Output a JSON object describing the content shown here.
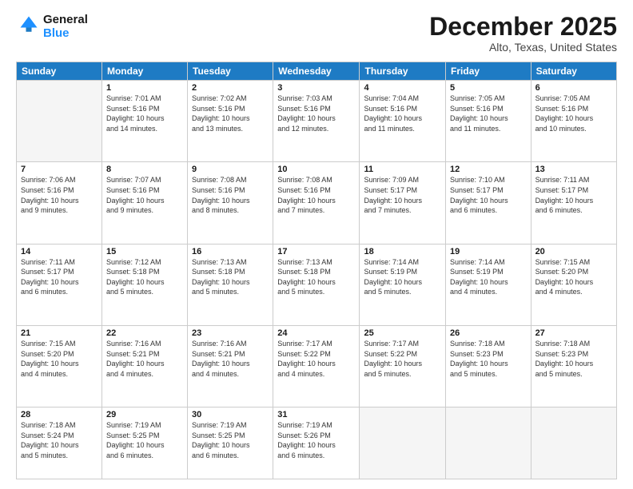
{
  "logo": {
    "line1": "General",
    "line2": "Blue"
  },
  "title": "December 2025",
  "subtitle": "Alto, Texas, United States",
  "header_days": [
    "Sunday",
    "Monday",
    "Tuesday",
    "Wednesday",
    "Thursday",
    "Friday",
    "Saturday"
  ],
  "weeks": [
    [
      {
        "num": "",
        "info": ""
      },
      {
        "num": "1",
        "info": "Sunrise: 7:01 AM\nSunset: 5:16 PM\nDaylight: 10 hours\nand 14 minutes."
      },
      {
        "num": "2",
        "info": "Sunrise: 7:02 AM\nSunset: 5:16 PM\nDaylight: 10 hours\nand 13 minutes."
      },
      {
        "num": "3",
        "info": "Sunrise: 7:03 AM\nSunset: 5:16 PM\nDaylight: 10 hours\nand 12 minutes."
      },
      {
        "num": "4",
        "info": "Sunrise: 7:04 AM\nSunset: 5:16 PM\nDaylight: 10 hours\nand 11 minutes."
      },
      {
        "num": "5",
        "info": "Sunrise: 7:05 AM\nSunset: 5:16 PM\nDaylight: 10 hours\nand 11 minutes."
      },
      {
        "num": "6",
        "info": "Sunrise: 7:05 AM\nSunset: 5:16 PM\nDaylight: 10 hours\nand 10 minutes."
      }
    ],
    [
      {
        "num": "7",
        "info": "Sunrise: 7:06 AM\nSunset: 5:16 PM\nDaylight: 10 hours\nand 9 minutes."
      },
      {
        "num": "8",
        "info": "Sunrise: 7:07 AM\nSunset: 5:16 PM\nDaylight: 10 hours\nand 9 minutes."
      },
      {
        "num": "9",
        "info": "Sunrise: 7:08 AM\nSunset: 5:16 PM\nDaylight: 10 hours\nand 8 minutes."
      },
      {
        "num": "10",
        "info": "Sunrise: 7:08 AM\nSunset: 5:16 PM\nDaylight: 10 hours\nand 7 minutes."
      },
      {
        "num": "11",
        "info": "Sunrise: 7:09 AM\nSunset: 5:17 PM\nDaylight: 10 hours\nand 7 minutes."
      },
      {
        "num": "12",
        "info": "Sunrise: 7:10 AM\nSunset: 5:17 PM\nDaylight: 10 hours\nand 6 minutes."
      },
      {
        "num": "13",
        "info": "Sunrise: 7:11 AM\nSunset: 5:17 PM\nDaylight: 10 hours\nand 6 minutes."
      }
    ],
    [
      {
        "num": "14",
        "info": "Sunrise: 7:11 AM\nSunset: 5:17 PM\nDaylight: 10 hours\nand 6 minutes."
      },
      {
        "num": "15",
        "info": "Sunrise: 7:12 AM\nSunset: 5:18 PM\nDaylight: 10 hours\nand 5 minutes."
      },
      {
        "num": "16",
        "info": "Sunrise: 7:13 AM\nSunset: 5:18 PM\nDaylight: 10 hours\nand 5 minutes."
      },
      {
        "num": "17",
        "info": "Sunrise: 7:13 AM\nSunset: 5:18 PM\nDaylight: 10 hours\nand 5 minutes."
      },
      {
        "num": "18",
        "info": "Sunrise: 7:14 AM\nSunset: 5:19 PM\nDaylight: 10 hours\nand 5 minutes."
      },
      {
        "num": "19",
        "info": "Sunrise: 7:14 AM\nSunset: 5:19 PM\nDaylight: 10 hours\nand 4 minutes."
      },
      {
        "num": "20",
        "info": "Sunrise: 7:15 AM\nSunset: 5:20 PM\nDaylight: 10 hours\nand 4 minutes."
      }
    ],
    [
      {
        "num": "21",
        "info": "Sunrise: 7:15 AM\nSunset: 5:20 PM\nDaylight: 10 hours\nand 4 minutes."
      },
      {
        "num": "22",
        "info": "Sunrise: 7:16 AM\nSunset: 5:21 PM\nDaylight: 10 hours\nand 4 minutes."
      },
      {
        "num": "23",
        "info": "Sunrise: 7:16 AM\nSunset: 5:21 PM\nDaylight: 10 hours\nand 4 minutes."
      },
      {
        "num": "24",
        "info": "Sunrise: 7:17 AM\nSunset: 5:22 PM\nDaylight: 10 hours\nand 4 minutes."
      },
      {
        "num": "25",
        "info": "Sunrise: 7:17 AM\nSunset: 5:22 PM\nDaylight: 10 hours\nand 5 minutes."
      },
      {
        "num": "26",
        "info": "Sunrise: 7:18 AM\nSunset: 5:23 PM\nDaylight: 10 hours\nand 5 minutes."
      },
      {
        "num": "27",
        "info": "Sunrise: 7:18 AM\nSunset: 5:23 PM\nDaylight: 10 hours\nand 5 minutes."
      }
    ],
    [
      {
        "num": "28",
        "info": "Sunrise: 7:18 AM\nSunset: 5:24 PM\nDaylight: 10 hours\nand 5 minutes."
      },
      {
        "num": "29",
        "info": "Sunrise: 7:19 AM\nSunset: 5:25 PM\nDaylight: 10 hours\nand 6 minutes."
      },
      {
        "num": "30",
        "info": "Sunrise: 7:19 AM\nSunset: 5:25 PM\nDaylight: 10 hours\nand 6 minutes."
      },
      {
        "num": "31",
        "info": "Sunrise: 7:19 AM\nSunset: 5:26 PM\nDaylight: 10 hours\nand 6 minutes."
      },
      {
        "num": "",
        "info": ""
      },
      {
        "num": "",
        "info": ""
      },
      {
        "num": "",
        "info": ""
      }
    ]
  ]
}
